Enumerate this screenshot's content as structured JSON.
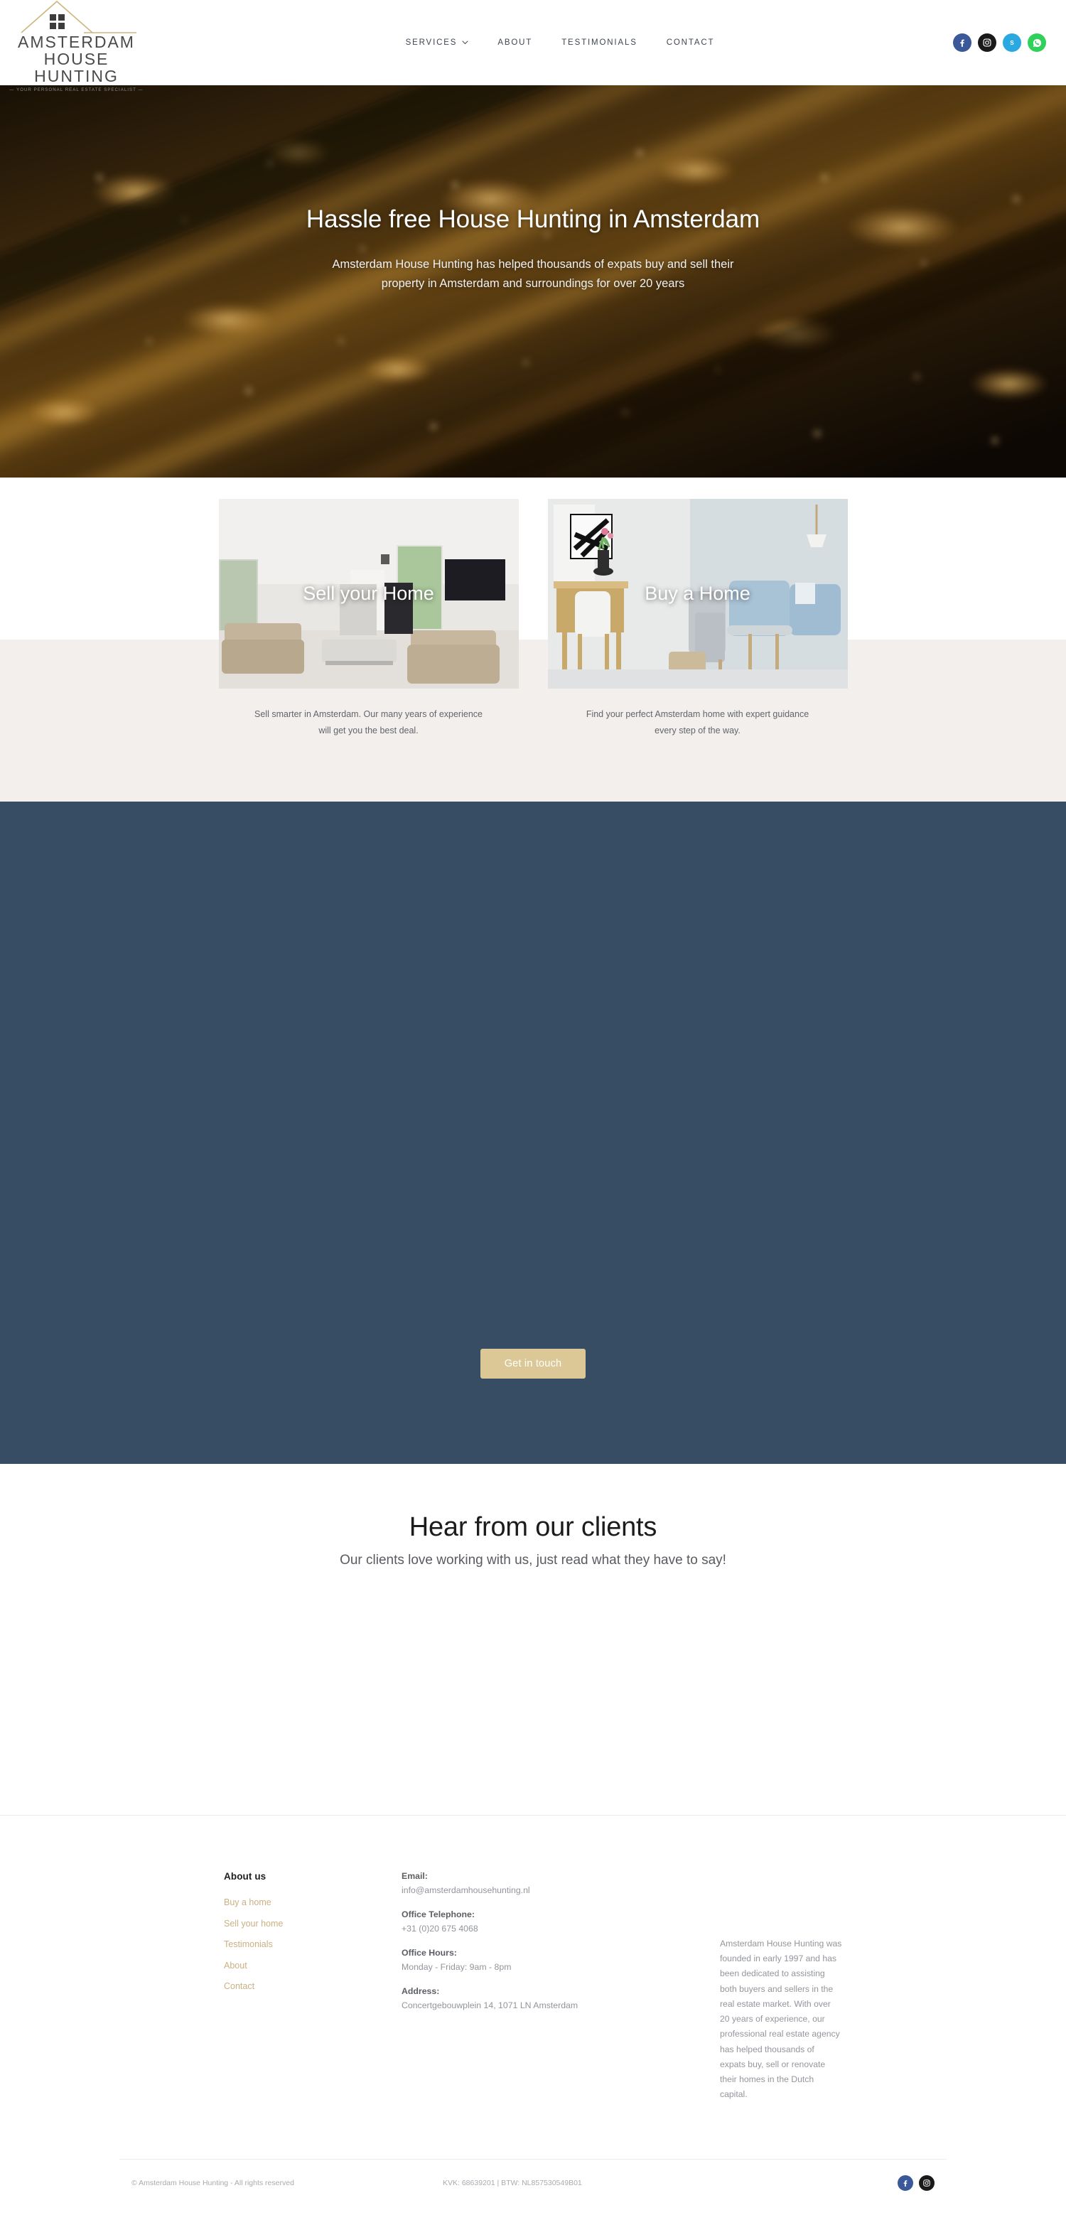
{
  "header": {
    "logo": {
      "name_line1": "AMSTERDAM",
      "name_line2": "HOUSE HUNTING",
      "tagline": "— YOUR PERSONAL REAL ESTATE SPECIALIST —"
    },
    "nav": [
      {
        "label": "SERVICES",
        "has_dropdown": true,
        "icon": "chevron-down-icon"
      },
      {
        "label": "ABOUT",
        "has_dropdown": false
      },
      {
        "label": "TESTIMONIALS",
        "has_dropdown": false
      },
      {
        "label": "CONTACT",
        "has_dropdown": false
      }
    ],
    "social": [
      {
        "name": "facebook-icon",
        "color": "#3b5998"
      },
      {
        "name": "instagram-icon",
        "color": "#1a1a1a"
      },
      {
        "name": "skype-icon",
        "color": "#2aa9e0"
      },
      {
        "name": "whatsapp-icon",
        "color": "#2fd15a"
      }
    ]
  },
  "hero": {
    "title": "Hassle free House Hunting in Amsterdam",
    "subtitle": "Amsterdam House Hunting has helped thousands of expats buy and sell their property in Amsterdam and surroundings for over 20 years"
  },
  "services": {
    "cards": [
      {
        "title": "Sell your Home",
        "description": "Sell smarter in Amsterdam. Our many years of experience will get you the best deal."
      },
      {
        "title": "Buy a Home",
        "description": "Find your perfect Amsterdam home with expert guidance every step of the way."
      }
    ]
  },
  "cta": {
    "button_label": "Get in touch",
    "background_color": "#374d64",
    "button_color": "#dbc896"
  },
  "testimonials": {
    "title": "Hear from our clients",
    "subtitle": "Our clients love working with us, just read what they have to say!"
  },
  "footer": {
    "about_heading": "About us",
    "links": [
      {
        "label": "Buy a home"
      },
      {
        "label": "Sell your home"
      },
      {
        "label": "Testimonials"
      },
      {
        "label": "About"
      },
      {
        "label": "Contact"
      }
    ],
    "contact": [
      {
        "label": "Email:",
        "value": "info@amsterdamhousehunting.nl"
      },
      {
        "label": "Office Telephone:",
        "value": "+31 (0)20 675 4068"
      },
      {
        "label": "Office Hours:",
        "value": "Monday - Friday: 9am - 8pm"
      },
      {
        "label": "Address:",
        "value": "Concertgebouwplein 14, 1071 LN Amsterdam"
      }
    ],
    "about_paragraph": "Amsterdam House Hunting was founded in early 1997 and has been dedicated to assisting both buyers and sellers in the real estate market. With over 20 years of experience, our professional real estate agency has helped thousands of expats buy, sell or renovate their homes in the Dutch capital.",
    "copyright": "© Amsterdam House Hunting - All rights reserved",
    "registration": "KVK: 68639201 | BTW: NL857530549B01",
    "social": [
      {
        "name": "facebook-icon",
        "color": "#3b5998"
      },
      {
        "name": "instagram-icon",
        "color": "#1a1a1a"
      }
    ]
  }
}
